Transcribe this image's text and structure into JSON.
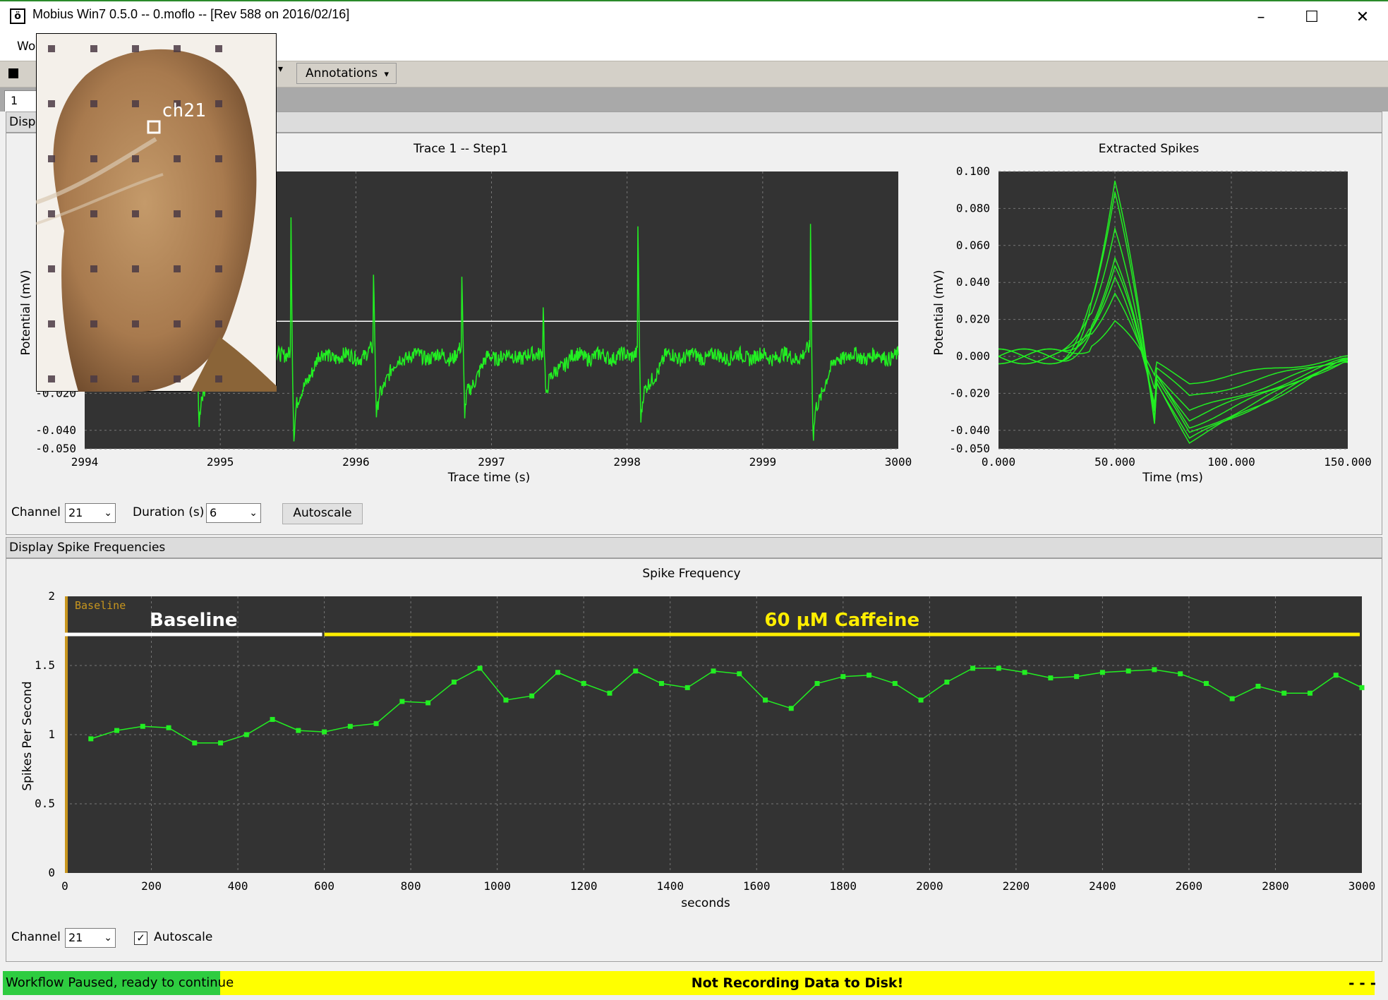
{
  "window": {
    "title": "Mobius Win7 0.5.0 -- 0.moflo -- [Rev 588 on 2016/02/16]",
    "icon_glyph": "ö",
    "minimize": "–",
    "maximize": "☐",
    "close": "✕"
  },
  "menubar": {
    "items": [
      "Wo"
    ]
  },
  "toolbar": {
    "annotations_label": "Annotations"
  },
  "tabs": [
    {
      "label": "1"
    }
  ],
  "overlay": {
    "channel_label": "ch21"
  },
  "trace_panel": {
    "header": "Displ",
    "channel_label": "Channel",
    "channel_value": "21",
    "duration_label": "Duration (s)",
    "duration_value": "6",
    "autoscale_button": "Autoscale"
  },
  "freq_panel": {
    "header": "Display Spike Frequencies",
    "channel_label": "Channel",
    "channel_value": "21",
    "autoscale_label": "Autoscale",
    "autoscale_checked": true
  },
  "status": {
    "workflow": "Workflow Paused, ready to continue",
    "recording": "Not Recording Data to Disk!",
    "indicator": "- - -"
  },
  "colors": {
    "plot_bg": "#333333",
    "trace": "#22ee22",
    "baseline_bar": "#ffffff",
    "caffeine_bar": "#ffee00",
    "marker_line": "#c8961e"
  },
  "chart_data": [
    {
      "type": "line",
      "title": "Trace 1 -- Step1",
      "xlabel": "Trace time (s)",
      "ylabel": "Potential (mV)",
      "xlim": [
        2994,
        3000
      ],
      "ylim": [
        -0.05,
        0.1
      ],
      "x_ticks": [
        "2994",
        "2995",
        "2996",
        "2997",
        "2998",
        "2999",
        "3000"
      ],
      "y_ticks": [
        "-0.050",
        "-0.040",
        "-0.020"
      ],
      "threshold": 0.019,
      "spike_times": [
        2994.82,
        2995.52,
        2996.13,
        2996.78,
        2997.38,
        2998.08,
        2999.35
      ],
      "spike_peaks": [
        0.015,
        0.085,
        0.045,
        0.048,
        0.034,
        0.072,
        0.094
      ],
      "spike_troughs": [
        -0.036,
        -0.045,
        -0.033,
        -0.032,
        -0.023,
        -0.035,
        -0.045
      ],
      "baseline": 0.0
    },
    {
      "type": "line",
      "title": "Extracted Spikes",
      "xlabel": "Time (ms)",
      "ylabel": "Potential (mV)",
      "xlim": [
        0,
        150
      ],
      "ylim": [
        -0.05,
        0.1
      ],
      "x_ticks": [
        "0.000",
        "50.000",
        "100.000",
        "150.000"
      ],
      "y_ticks": [
        "-0.050",
        "-0.040",
        "-0.020",
        "0.000",
        "0.020",
        "0.040",
        "0.060",
        "0.080",
        "0.100"
      ],
      "peak_time": 50,
      "peaks": [
        0.094,
        0.088,
        0.07,
        0.054,
        0.048,
        0.042,
        0.035,
        0.02
      ],
      "troughs": [
        -0.046,
        -0.045,
        -0.042,
        -0.038,
        -0.034,
        -0.03,
        -0.022,
        -0.014
      ]
    },
    {
      "type": "line",
      "title": "Spike Frequency",
      "xlabel": "seconds",
      "ylabel": "Spikes Per Second",
      "xlim": [
        0,
        3000
      ],
      "ylim": [
        0,
        2
      ],
      "x_ticks": [
        "0",
        "200",
        "400",
        "600",
        "800",
        "1000",
        "1200",
        "1400",
        "1600",
        "1800",
        "2000",
        "2200",
        "2400",
        "2600",
        "2800",
        "3000"
      ],
      "y_ticks": [
        "0",
        "0.5",
        "1",
        "1.5",
        "2"
      ],
      "annotations": [
        {
          "label": "Baseline",
          "start": 0,
          "end": 595
        },
        {
          "label": "60 µM Caffeine",
          "start": 600,
          "end": 2995
        }
      ],
      "marker_label": "Baseline",
      "x": [
        60,
        120,
        180,
        240,
        300,
        360,
        420,
        480,
        540,
        600,
        660,
        720,
        780,
        840,
        900,
        960,
        1020,
        1080,
        1140,
        1200,
        1260,
        1320,
        1380,
        1440,
        1500,
        1560,
        1620,
        1680,
        1740,
        1800,
        1860,
        1920,
        1980,
        2040,
        2100,
        2160,
        2220,
        2280,
        2340,
        2400,
        2460,
        2520,
        2580,
        2640,
        2700,
        2760,
        2820,
        2880,
        2940,
        3000
      ],
      "values": [
        0.97,
        1.03,
        1.06,
        1.05,
        0.94,
        0.94,
        1.0,
        1.11,
        1.03,
        1.02,
        1.06,
        1.08,
        1.24,
        1.23,
        1.38,
        1.48,
        1.25,
        1.28,
        1.45,
        1.37,
        1.3,
        1.46,
        1.37,
        1.34,
        1.46,
        1.44,
        1.25,
        1.19,
        1.37,
        1.42,
        1.43,
        1.37,
        1.25,
        1.38,
        1.48,
        1.48,
        1.45,
        1.41,
        1.42,
        1.45,
        1.46,
        1.47,
        1.44,
        1.37,
        1.26,
        1.35,
        1.3,
        1.3,
        1.43,
        1.34
      ]
    }
  ]
}
